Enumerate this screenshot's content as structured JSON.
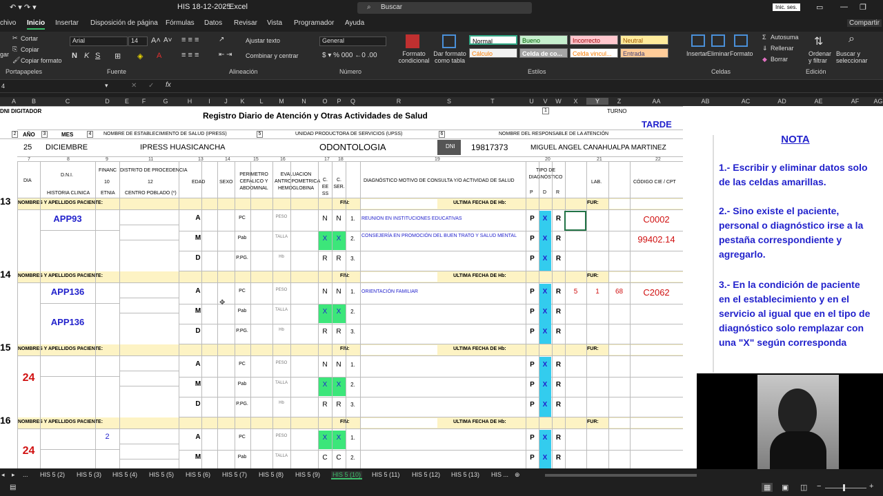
{
  "window": {
    "file_title": "HIS 18-12-2025",
    "app": "Excel",
    "search_placeholder": "Buscar",
    "signin": "Inic. ses."
  },
  "ribbon_tabs": [
    "chivo",
    "Inicio",
    "Insertar",
    "Disposición de página",
    "Fórmulas",
    "Datos",
    "Revisar",
    "Vista",
    "Programador",
    "Ayuda"
  ],
  "share": "Compartir",
  "clipboard": {
    "cut": "Cortar",
    "copy": "Copiar",
    "format_painter": "Copiar formato",
    "paste": "gar",
    "label": "Portapapeles"
  },
  "font": {
    "name": "Arial",
    "size": "14",
    "bold": "N",
    "italic": "K",
    "underline": "S",
    "label": "Fuente"
  },
  "alignment": {
    "wrap": "Ajustar texto",
    "merge": "Combinar y centrar",
    "label": "Alineación"
  },
  "number": {
    "format": "General",
    "label": "Número"
  },
  "styles": {
    "cond": "Formato condicional",
    "table": "Dar formato como tabla",
    "normal": "Normal",
    "bueno": "Bueno",
    "incorrecto": "Incorrecto",
    "neutral": "Neutral",
    "calculo": "Cálculo",
    "celda_co": "Celda de co...",
    "celda_vin": "Celda vincul...",
    "entrada": "Entrada",
    "label": "Estilos"
  },
  "cells": {
    "insert": "Insertar",
    "delete": "Eliminar",
    "format": "Formato",
    "label": "Celdas"
  },
  "editing": {
    "autosum": "Autosuma",
    "fill": "Rellenar",
    "clear": "Borrar",
    "sort": "Ordenar y filtrar",
    "find": "Buscar y seleccionar",
    "label": "Edición"
  },
  "namebox": "4",
  "columns": [
    "A",
    "B",
    "C",
    "D",
    "E",
    "F",
    "G",
    "H",
    "I",
    "J",
    "K",
    "L",
    "M",
    "N",
    "O",
    "P",
    "Q",
    "R",
    "S",
    "T",
    "U",
    "V",
    "W",
    "X",
    "Y",
    "Z",
    "AA",
    "AB",
    "AC",
    "AD",
    "AE",
    "AF",
    "AG"
  ],
  "sheet": {
    "top_left": "DNI DIGITADOR",
    "title": "Registro Diario de Atención y Otras Actividades de Salud",
    "turno_label": "TURNO",
    "turno": "TARDE",
    "hdr_anio": "AÑO",
    "hdr_mes": "MES",
    "hdr_estab": "NOMBRE DE ESTABLECIMIENTO DE SALUD (IPRESS)",
    "hdr_ups": "UNIDAD PRODUCTORA DE SERVICIOS (UPSS)",
    "hdr_resp": "NOMBRE DEL RESPONSABLE DE LA ATENCIÓN",
    "n1": "1",
    "n2": "2",
    "n3": "3",
    "n4": "4",
    "n5": "5",
    "n6": "6",
    "anio": "25",
    "mes": "DICIEMBRE",
    "estab": "IPRESS HUASICANCHA",
    "ups": "ODONTOLOGIA",
    "dni_label": "DNI",
    "dni": "19817373",
    "resp": "MIGUEL ANGEL CANAHUALPA MARTINEZ",
    "colnums": [
      "7",
      "8",
      "9",
      "11",
      "13",
      "14",
      "15",
      "16",
      "17",
      "18",
      "19",
      "20",
      "21",
      "22"
    ],
    "h_dia": "DIA",
    "h_dni": "D.N.I.",
    "h_hc": "HISTORIA CLINICA",
    "h_financ": "FINANC",
    "h_10": "10",
    "h_etnia": "ETNIA",
    "h_distrito": "DISTRITO DE PROCEDENCIA",
    "h_12": "12",
    "h_centro": "CENTRO POBLADO (*)",
    "h_edad": "EDAD",
    "h_sexo": "SEXO",
    "h_perim": "PERIMETRO CEFALICO Y ABDOMINAL",
    "h_eval": "EVALUACION ANTROPOMETRICA HEMOGLOBINA",
    "h_ces": "C. EE SS",
    "h_cser": "C. SER.",
    "h_diag": "DIAGNÓSTICO MOTIVO DE CONSULTA Y/O ACTIVIDAD DE SALUD",
    "h_tipo": "TIPO DE DIAGNÓSTICO",
    "h_p": "P",
    "h_d": "D",
    "h_r": "R",
    "h_lab": "LAB.",
    "h_cie": "CÓDIGO CIE / CPT",
    "nombres": "NOMBRES Y APELLIDOS PACIENTE:",
    "fn": "F/N:",
    "ult": "ULTIMA FECHA DE Hb:",
    "fur": "FUR:",
    "pc": "PC",
    "pab": "Pab",
    "ppg": "P.PG.",
    "peso": "PESO",
    "talla": "TALLA",
    "hb": "Hb",
    "blocks": [
      {
        "num": "13",
        "hc1": "APP93",
        "hc2": "",
        "dia": "",
        "fin": "",
        "ces": [
          "N",
          "X",
          "R"
        ],
        "cser": [
          "N",
          "X",
          "R"
        ],
        "diag1": "REUNION EN INSTITUCIONES EDUCATIVAS",
        "diag2": "CONSEJERÍA EN PROMOCIÓN DEL BUEN TRATO Y SALUD MENTAL",
        "lab": [
          "",
          "",
          ""
        ],
        "cie1": "C0002",
        "cie2": "99402.14"
      },
      {
        "num": "14",
        "hc1": "APP136",
        "hc2": "APP136",
        "dia": "",
        "fin": "",
        "ces": [
          "N",
          "X",
          "R"
        ],
        "cser": [
          "N",
          "X",
          "R"
        ],
        "diag1": "ORIENTACIÓN FAMILIAR",
        "diag2": "",
        "lab": [
          "5",
          "1",
          "68"
        ],
        "cie1": "C2062",
        "cie2": ""
      },
      {
        "num": "15",
        "hc1": "",
        "hc2": "",
        "dia": "24",
        "fin": "",
        "ces": [
          "N",
          "X",
          "R"
        ],
        "cser": [
          "N",
          "X",
          "R"
        ],
        "diag1": "",
        "diag2": "",
        "lab": [
          "",
          "",
          ""
        ],
        "cie1": "",
        "cie2": ""
      },
      {
        "num": "16",
        "hc1": "",
        "hc2": "",
        "dia": "24",
        "fin": "2",
        "ces": [
          "X",
          "C",
          ""
        ],
        "cser": [
          "X",
          "C",
          ""
        ],
        "diag1": "",
        "diag2": "",
        "lab": [
          "",
          "",
          ""
        ],
        "cie1": "",
        "cie2": ""
      }
    ],
    "edad_rows": [
      "A",
      "M",
      "D"
    ],
    "row_idx": [
      "1.",
      "2.",
      "3."
    ],
    "pdx": [
      "P",
      "X",
      "R"
    ]
  },
  "nota": {
    "title": "NOTA",
    "p1": "1.- Escribir y eliminar datos solo de las celdas amarillas.",
    "p2": "2.- Sino existe el paciente, personal o diagnóstico irse a la pestaña correspondiente y agregarlo.",
    "p3": "3.- En la condición de paciente en el establecimiento y en el servicio al igual que en el tipo de diagnóstico solo remplazar con una \"X\" según corresponda"
  },
  "sheet_tabs": [
    "...",
    "HIS 5 (2)",
    "HIS 5 (3)",
    "HIS 5 (4)",
    "HIS 5 (5)",
    "HIS 5 (6)",
    "HIS 5 (7)",
    "HIS 5 (8)",
    "HIS 5 (9)",
    "HIS 5 (10)",
    "HIS 5 (11)",
    "HIS 5 (12)",
    "HIS 5 (13)",
    "HIS ..."
  ],
  "active_sheet": "HIS 5 (10)",
  "colors": {
    "accent": "#3cbf6b",
    "cyan": "#33ccee",
    "green": "#3ce67a",
    "yellow": "#fdf3c4",
    "blue_text": "#2222cc",
    "red_text": "#d01010"
  }
}
